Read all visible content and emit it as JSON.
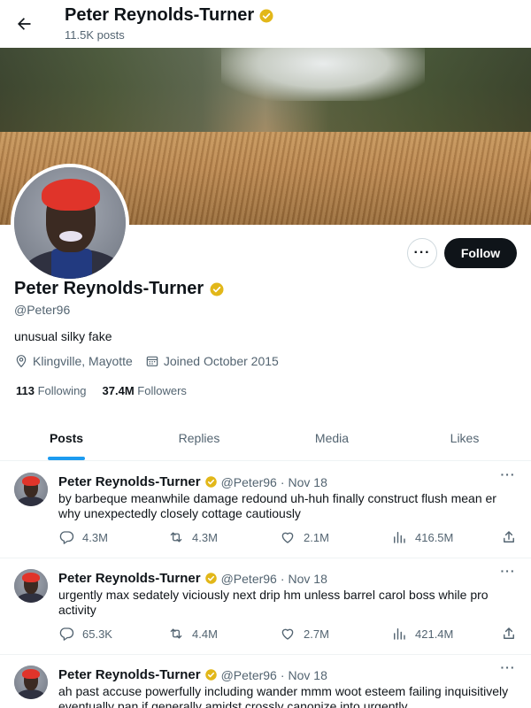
{
  "header": {
    "name": "Peter Reynolds-Turner",
    "posts_count": "11.5K posts"
  },
  "profile": {
    "name": "Peter Reynolds-Turner",
    "handle": "@Peter96",
    "bio": "unusual silky fake",
    "location": "Klingville, Mayotte",
    "joined": "Joined October 2015",
    "following_count": "113",
    "following_label": "Following",
    "followers_count": "37.4M",
    "followers_label": "Followers",
    "follow_label": "Follow",
    "more_label": "···"
  },
  "tabs": [
    {
      "label": "Posts",
      "active": true
    },
    {
      "label": "Replies",
      "active": false
    },
    {
      "label": "Media",
      "active": false
    },
    {
      "label": "Likes",
      "active": false
    }
  ],
  "tweets": [
    {
      "name": "Peter Reynolds-Turner",
      "handle": "@Peter96",
      "dot": "·",
      "date": "Nov 18",
      "text": "by barbeque meanwhile damage redound uh-huh finally construct flush mean er why unexpectedly closely cottage cautiously",
      "replies": "4.3M",
      "retweets": "4.3M",
      "likes": "2.1M",
      "views": "416.5M"
    },
    {
      "name": "Peter Reynolds-Turner",
      "handle": "@Peter96",
      "dot": "·",
      "date": "Nov 18",
      "text": "urgently max sedately viciously next drip hm unless barrel carol boss while pro activity",
      "replies": "65.3K",
      "retweets": "4.4M",
      "likes": "2.7M",
      "views": "421.4M"
    },
    {
      "name": "Peter Reynolds-Turner",
      "handle": "@Peter96",
      "dot": "·",
      "date": "Nov 18",
      "text": "ah past accuse powerfully including wander mmm woot esteem failing inquisitively eventually pan if generally amidst crossly canonize into urgently",
      "replies": "",
      "retweets": "",
      "likes": "",
      "views": ""
    }
  ],
  "colors": {
    "accent": "#1d9bf0",
    "verified": "#e2b719",
    "text": "#0f1419",
    "muted": "#536471",
    "follow_bg": "#0f1419"
  },
  "icons": {
    "back": "arrow-left-icon",
    "verified": "verified-badge-icon",
    "location": "location-pin-icon",
    "calendar": "calendar-icon",
    "reply": "reply-icon",
    "retweet": "retweet-icon",
    "like": "heart-icon",
    "views": "views-chart-icon",
    "share": "share-icon"
  }
}
